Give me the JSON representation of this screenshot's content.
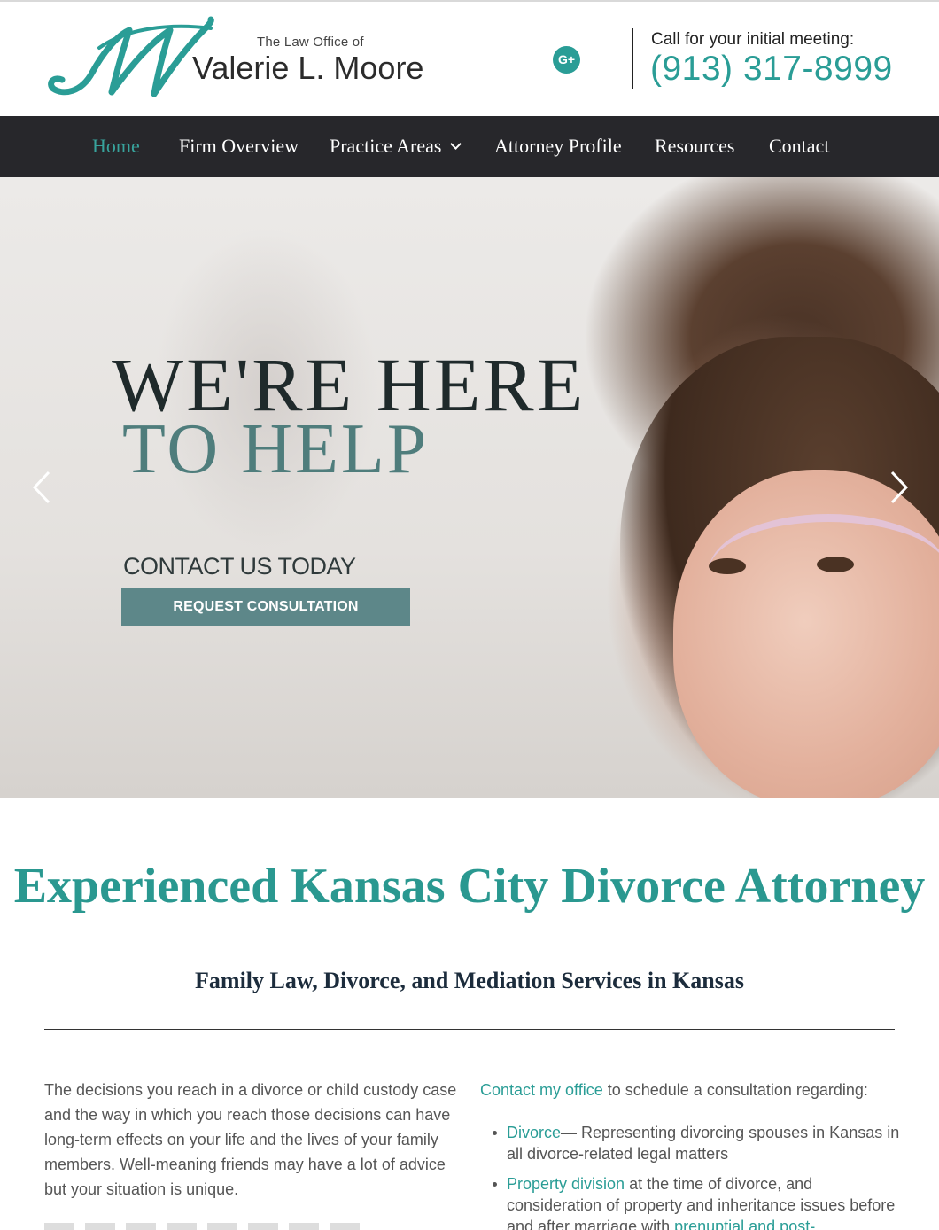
{
  "header": {
    "logo_monogram": "M",
    "logo_small": "The Law Office of",
    "logo_name": "Valerie L. Moore",
    "social_icon": "google-plus-icon",
    "social_label": "G+",
    "call_label": "Call for your initial meeting:",
    "phone": "(913) 317-8999"
  },
  "nav": {
    "items": [
      {
        "label": "Home",
        "active": true
      },
      {
        "label": "Firm Overview"
      },
      {
        "label": "Practice Areas",
        "has_dropdown": true
      },
      {
        "label": "Attorney Profile"
      },
      {
        "label": "Resources"
      },
      {
        "label": "Contact"
      }
    ]
  },
  "hero": {
    "title_line1": "WE'RE HERE",
    "title_line2": "TO HELP",
    "contact": "CONTACT US TODAY",
    "button": "REQUEST CONSULTATION"
  },
  "content": {
    "heading": "Experienced Kansas City Divorce Attorney",
    "subheading": "Family Law, Divorce, and Mediation Services in Kansas",
    "left_paragraph": "The decisions you reach in a divorce or child custody case and the way in which you reach those decisions can have long-term effects on your life and the lives of your family members. Well-meaning friends may have a lot of advice but your situation is unique.",
    "right_intro_link": "Contact my office",
    "right_intro_rest": " to schedule a consultation regarding:",
    "bullets": [
      {
        "link": "Divorce",
        "text": "— Representing divorcing spouses in Kansas in all divorce-related legal matters"
      },
      {
        "link": "Property division",
        "text": " at the time of divorce, and consideration of property and inheritance issues before and after marriage with ",
        "link2": "prenuptial and post-"
      }
    ]
  },
  "colors": {
    "accent": "#2a9d96",
    "nav_bg": "#27272b",
    "button_bg": "#5d8789"
  }
}
